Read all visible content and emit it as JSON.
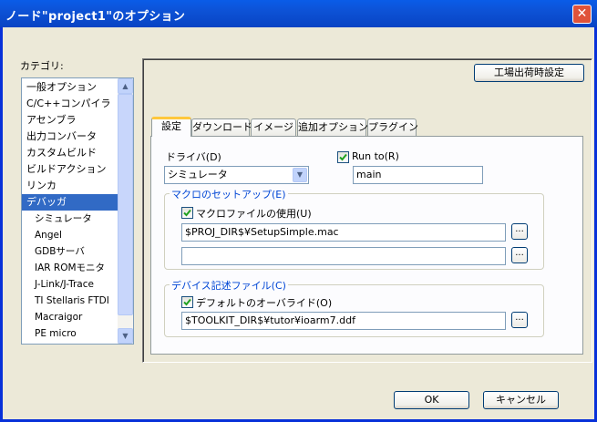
{
  "window": {
    "title": "ノード\"project1\"のオプション",
    "close_glyph": "✕"
  },
  "category": {
    "label": "カテゴリ:",
    "items": [
      {
        "label": "一般オプション",
        "level": 0
      },
      {
        "label": "C/C++コンパイラ",
        "level": 0
      },
      {
        "label": "アセンブラ",
        "level": 0
      },
      {
        "label": "出力コンバータ",
        "level": 0
      },
      {
        "label": "カスタムビルド",
        "level": 0
      },
      {
        "label": "ビルドアクション",
        "level": 0
      },
      {
        "label": "リンカ",
        "level": 0
      },
      {
        "label": "デバッガ",
        "level": 0,
        "selected": true
      },
      {
        "label": "シミュレータ",
        "level": 1
      },
      {
        "label": "Angel",
        "level": 1
      },
      {
        "label": "GDBサーバ",
        "level": 1
      },
      {
        "label": "IAR ROMモニタ",
        "level": 1
      },
      {
        "label": "J-Link/J-Trace",
        "level": 1
      },
      {
        "label": "TI Stellaris FTDI",
        "level": 1
      },
      {
        "label": "Macraigor",
        "level": 1
      },
      {
        "label": "PE micro",
        "level": 1
      }
    ]
  },
  "factory_settings_label": "工場出荷時設定",
  "tabs": [
    {
      "label": "設定",
      "active": true
    },
    {
      "label": "ダウンロード"
    },
    {
      "label": "イメージ"
    },
    {
      "label": "追加オプション"
    },
    {
      "label": "プラグイン"
    }
  ],
  "settings": {
    "driver_label": "ドライバ(D)",
    "driver_value": "シミュレータ",
    "run_to_label": "Run to(R)",
    "run_to_checked": true,
    "run_to_value": "main",
    "macro_group_title": "マクロのセットアップ(E)",
    "use_macro_label": "マクロファイルの使用(U)",
    "use_macro_checked": true,
    "macro_file_1": "$PROJ_DIR$¥SetupSimple.mac",
    "macro_file_2": "",
    "device_group_title": "デバイス記述ファイル(C)",
    "override_label": "デフォルトのオーバライド(O)",
    "override_checked": true,
    "device_file": "$TOOLKIT_DIR$¥tutor¥ioarm7.ddf",
    "browse_label": "..."
  },
  "buttons": {
    "ok": "OK",
    "cancel": "キャンセル"
  },
  "icons": {
    "scroll_up": "▲",
    "scroll_down": "▼",
    "dropdown": "▼"
  }
}
